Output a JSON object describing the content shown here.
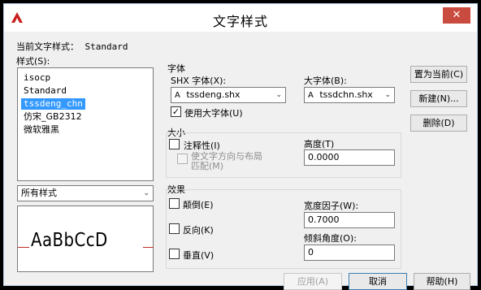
{
  "dialog": {
    "title": "文字样式",
    "close_symbol": "✕"
  },
  "current_style": {
    "label": "当前文字样式：",
    "value": "Standard"
  },
  "styles": {
    "label": "样式(S):",
    "items": [
      "isocp",
      "Standard",
      "tssdeng_chn",
      "仿宋_GB2312",
      "微软雅黑"
    ],
    "selected_index": 2,
    "filter_value": "所有样式",
    "arrow": "⌄"
  },
  "preview": {
    "text": "AaBbCcD"
  },
  "font": {
    "group_label": "字体",
    "shx_label": "SHX 字体(X):",
    "shx_value": "tssdeng.shx",
    "bigfont_label": "大字体(B):",
    "bigfont_value": "tssdchn.shx",
    "font_icon": "A",
    "use_bigfont_label": "使用大字体(U)",
    "use_bigfont_checked": true
  },
  "size": {
    "group_label": "大小",
    "annotative_label": "注释性(I)",
    "annotative_checked": false,
    "match_orientation_label_line1": "使文字方向与布局",
    "match_orientation_label_line2": "匹配(M)",
    "height_label": "高度(T)",
    "height_value": "0.0000"
  },
  "effects": {
    "group_label": "效果",
    "upside_down_label": "颠倒(E)",
    "backwards_label": "反向(K)",
    "vertical_label": "垂直(V)",
    "width_factor_label": "宽度因子(W):",
    "width_factor_value": "0.7000",
    "oblique_label": "倾斜角度(O):",
    "oblique_value": "0"
  },
  "buttons": {
    "set_current": "置为当前(C)",
    "new": "新建(N)...",
    "delete": "删除(D)",
    "apply": "应用(A)",
    "cancel": "取消",
    "help": "帮助(H)"
  },
  "colors": {
    "selection": "#3399ff",
    "close_button": "#c94b3f",
    "preview_line": "#c0302a"
  }
}
